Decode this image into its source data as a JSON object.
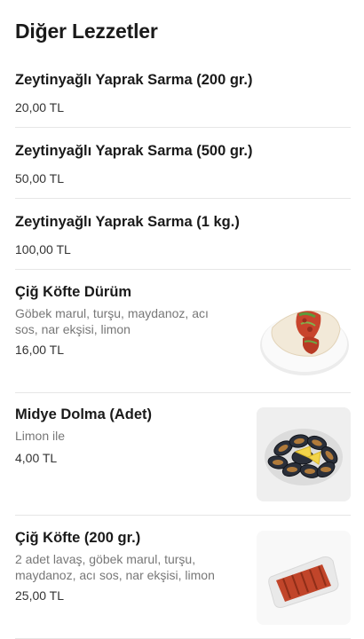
{
  "section": {
    "title": "Diğer Lezzetler"
  },
  "items": [
    {
      "name": "Zeytinyağlı Yaprak Sarma (200 gr.)",
      "desc": "",
      "price": "20,00 TL",
      "image": ""
    },
    {
      "name": "Zeytinyağlı Yaprak Sarma (500 gr.)",
      "desc": "",
      "price": "50,00 TL",
      "image": ""
    },
    {
      "name": "Zeytinyağlı Yaprak Sarma (1 kg.)",
      "desc": "",
      "price": "100,00 TL",
      "image": ""
    },
    {
      "name": "Çiğ Köfte Dürüm",
      "desc": "Göbek marul, turşu, maydanoz, acı sos, nar ekşisi, limon",
      "price": "16,00 TL",
      "image": "durum-wrap-photo"
    },
    {
      "name": "Midye Dolma (Adet)",
      "desc": "Limon ile",
      "price": "4,00 TL",
      "image": "stuffed-mussels-photo"
    },
    {
      "name": "Çiğ Köfte (200 gr.)",
      "desc": "2 adet lavaş, göbek marul, turşu, maydanoz, acı sos, nar ekşisi, limon",
      "price": "25,00 TL",
      "image": "cig-kofte-tray-photo"
    }
  ]
}
